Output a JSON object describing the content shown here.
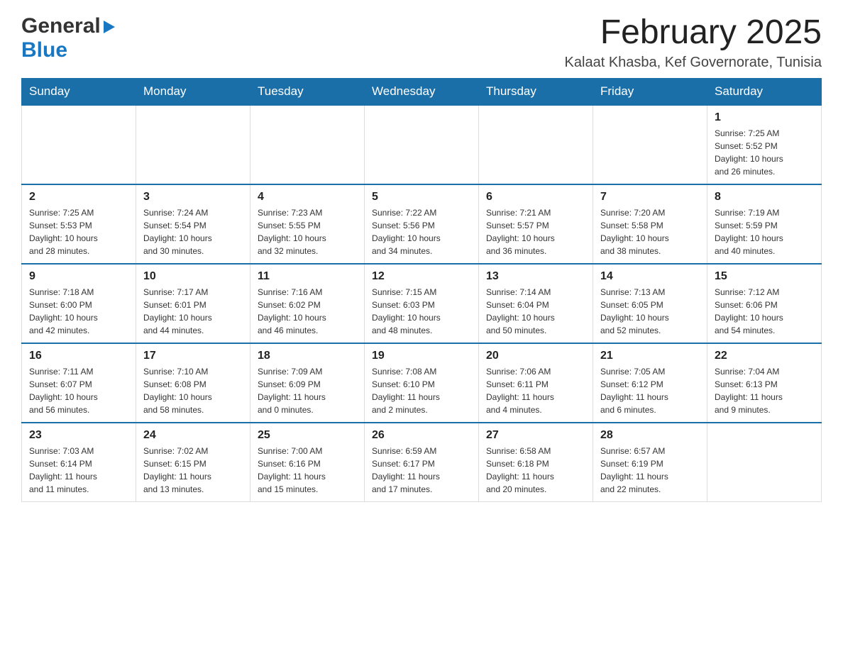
{
  "header": {
    "logo_general": "General",
    "logo_blue": "Blue",
    "month_title": "February 2025",
    "location": "Kalaat Khasba, Kef Governorate, Tunisia"
  },
  "calendar": {
    "days_of_week": [
      "Sunday",
      "Monday",
      "Tuesday",
      "Wednesday",
      "Thursday",
      "Friday",
      "Saturday"
    ],
    "weeks": [
      [
        {
          "day": "",
          "info": ""
        },
        {
          "day": "",
          "info": ""
        },
        {
          "day": "",
          "info": ""
        },
        {
          "day": "",
          "info": ""
        },
        {
          "day": "",
          "info": ""
        },
        {
          "day": "",
          "info": ""
        },
        {
          "day": "1",
          "info": "Sunrise: 7:25 AM\nSunset: 5:52 PM\nDaylight: 10 hours\nand 26 minutes."
        }
      ],
      [
        {
          "day": "2",
          "info": "Sunrise: 7:25 AM\nSunset: 5:53 PM\nDaylight: 10 hours\nand 28 minutes."
        },
        {
          "day": "3",
          "info": "Sunrise: 7:24 AM\nSunset: 5:54 PM\nDaylight: 10 hours\nand 30 minutes."
        },
        {
          "day": "4",
          "info": "Sunrise: 7:23 AM\nSunset: 5:55 PM\nDaylight: 10 hours\nand 32 minutes."
        },
        {
          "day": "5",
          "info": "Sunrise: 7:22 AM\nSunset: 5:56 PM\nDaylight: 10 hours\nand 34 minutes."
        },
        {
          "day": "6",
          "info": "Sunrise: 7:21 AM\nSunset: 5:57 PM\nDaylight: 10 hours\nand 36 minutes."
        },
        {
          "day": "7",
          "info": "Sunrise: 7:20 AM\nSunset: 5:58 PM\nDaylight: 10 hours\nand 38 minutes."
        },
        {
          "day": "8",
          "info": "Sunrise: 7:19 AM\nSunset: 5:59 PM\nDaylight: 10 hours\nand 40 minutes."
        }
      ],
      [
        {
          "day": "9",
          "info": "Sunrise: 7:18 AM\nSunset: 6:00 PM\nDaylight: 10 hours\nand 42 minutes."
        },
        {
          "day": "10",
          "info": "Sunrise: 7:17 AM\nSunset: 6:01 PM\nDaylight: 10 hours\nand 44 minutes."
        },
        {
          "day": "11",
          "info": "Sunrise: 7:16 AM\nSunset: 6:02 PM\nDaylight: 10 hours\nand 46 minutes."
        },
        {
          "day": "12",
          "info": "Sunrise: 7:15 AM\nSunset: 6:03 PM\nDaylight: 10 hours\nand 48 minutes."
        },
        {
          "day": "13",
          "info": "Sunrise: 7:14 AM\nSunset: 6:04 PM\nDaylight: 10 hours\nand 50 minutes."
        },
        {
          "day": "14",
          "info": "Sunrise: 7:13 AM\nSunset: 6:05 PM\nDaylight: 10 hours\nand 52 minutes."
        },
        {
          "day": "15",
          "info": "Sunrise: 7:12 AM\nSunset: 6:06 PM\nDaylight: 10 hours\nand 54 minutes."
        }
      ],
      [
        {
          "day": "16",
          "info": "Sunrise: 7:11 AM\nSunset: 6:07 PM\nDaylight: 10 hours\nand 56 minutes."
        },
        {
          "day": "17",
          "info": "Sunrise: 7:10 AM\nSunset: 6:08 PM\nDaylight: 10 hours\nand 58 minutes."
        },
        {
          "day": "18",
          "info": "Sunrise: 7:09 AM\nSunset: 6:09 PM\nDaylight: 11 hours\nand 0 minutes."
        },
        {
          "day": "19",
          "info": "Sunrise: 7:08 AM\nSunset: 6:10 PM\nDaylight: 11 hours\nand 2 minutes."
        },
        {
          "day": "20",
          "info": "Sunrise: 7:06 AM\nSunset: 6:11 PM\nDaylight: 11 hours\nand 4 minutes."
        },
        {
          "day": "21",
          "info": "Sunrise: 7:05 AM\nSunset: 6:12 PM\nDaylight: 11 hours\nand 6 minutes."
        },
        {
          "day": "22",
          "info": "Sunrise: 7:04 AM\nSunset: 6:13 PM\nDaylight: 11 hours\nand 9 minutes."
        }
      ],
      [
        {
          "day": "23",
          "info": "Sunrise: 7:03 AM\nSunset: 6:14 PM\nDaylight: 11 hours\nand 11 minutes."
        },
        {
          "day": "24",
          "info": "Sunrise: 7:02 AM\nSunset: 6:15 PM\nDaylight: 11 hours\nand 13 minutes."
        },
        {
          "day": "25",
          "info": "Sunrise: 7:00 AM\nSunset: 6:16 PM\nDaylight: 11 hours\nand 15 minutes."
        },
        {
          "day": "26",
          "info": "Sunrise: 6:59 AM\nSunset: 6:17 PM\nDaylight: 11 hours\nand 17 minutes."
        },
        {
          "day": "27",
          "info": "Sunrise: 6:58 AM\nSunset: 6:18 PM\nDaylight: 11 hours\nand 20 minutes."
        },
        {
          "day": "28",
          "info": "Sunrise: 6:57 AM\nSunset: 6:19 PM\nDaylight: 11 hours\nand 22 minutes."
        },
        {
          "day": "",
          "info": ""
        }
      ]
    ]
  }
}
